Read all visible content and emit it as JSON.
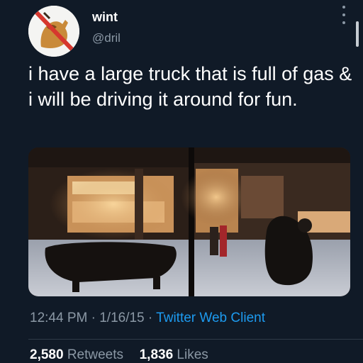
{
  "author": {
    "display_name": "wint",
    "handle": "@dril",
    "avatar_icon": "avatar-image"
  },
  "tweet": {
    "text": "i have a large truck that is full of gas & i will be driving it around for fun.",
    "time": "12:44 PM",
    "separator": "·",
    "date": "1/16/15",
    "client": "Twitter Web Client"
  },
  "media": {
    "description_icon": "photo"
  },
  "stats": {
    "retweets_count": "2,580",
    "retweets_label": "Retweets",
    "likes_count": "1,836",
    "likes_label": "Likes"
  },
  "colors": {
    "background": "#101a27",
    "secondary_text": "#8b98a5",
    "link": "#1d9bf0"
  }
}
